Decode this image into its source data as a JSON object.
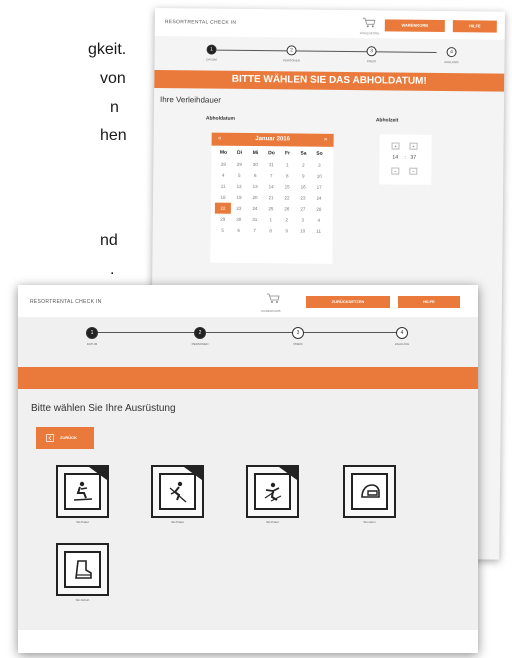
{
  "background_text": {
    "lines": [
      "gkeit.",
      "von",
      "n",
      "hen",
      "",
      "nd",
      "."
    ]
  },
  "back_window": {
    "brand": "RESORTRENTAL CHECK IN",
    "cart_label": "WARENKORB",
    "btn_primary": "WARENKORB",
    "btn_secondary": "HILFE",
    "steps": [
      {
        "num": "1",
        "label": "DATUM",
        "done": true
      },
      {
        "num": "2",
        "label": "PERSONEN",
        "done": false
      },
      {
        "num": "3",
        "label": "PREIS",
        "done": false
      },
      {
        "num": "4",
        "label": "ZAHLUNG",
        "done": false
      }
    ],
    "banner": "BITTE WÄHLEN SIE DAS ABHOLDATUM!",
    "section_title": "Ihre Verleihdauer",
    "date_label": "Abholdatum",
    "time_label": "Abholzeit",
    "calendar": {
      "month": "Januar 2016",
      "prev": "«",
      "next": "»",
      "weekdays": [
        "Mo",
        "Di",
        "Mi",
        "Do",
        "Fr",
        "Sa",
        "So"
      ],
      "rows": [
        [
          "28",
          "29",
          "30",
          "31",
          "1",
          "2",
          "3"
        ],
        [
          "4",
          "5",
          "6",
          "7",
          "8",
          "9",
          "10"
        ],
        [
          "11",
          "12",
          "13",
          "14",
          "15",
          "16",
          "17"
        ],
        [
          "18",
          "19",
          "20",
          "21",
          "22",
          "23",
          "24"
        ],
        [
          "22",
          "23",
          "24",
          "25",
          "26",
          "27",
          "28"
        ],
        [
          "29",
          "30",
          "31",
          "1",
          "2",
          "3",
          "4"
        ],
        [
          "5",
          "6",
          "7",
          "8",
          "9",
          "10",
          "11"
        ]
      ],
      "selected": "22"
    },
    "time": {
      "hour": "14",
      "sep": ":",
      "minute": "37",
      "up": "+",
      "down": "−"
    }
  },
  "front_window": {
    "brand": "RESORTRENTAL CHECK IN",
    "cart_label": "WARENKORB",
    "btn_primary": "ZURÜCKSETZEN",
    "btn_secondary": "HILFE",
    "steps": [
      {
        "num": "1",
        "label": "DATUM",
        "done": true
      },
      {
        "num": "2",
        "label": "PERSONEN",
        "done": true
      },
      {
        "num": "3",
        "label": "PREIS",
        "done": false
      },
      {
        "num": "4",
        "label": "ZAHLUNG",
        "done": false
      }
    ],
    "section_title": "Bitte wählen Sie Ihre Ausrüstung",
    "back_button": "ZURÜCK",
    "back_icon": "arrow-left-icon",
    "tiles": [
      {
        "label": "Ski-Paket",
        "icon": "ski-sitting-icon",
        "corner": true
      },
      {
        "label": "Ski-Paket",
        "icon": "ski-downhill-icon",
        "corner": true
      },
      {
        "label": "Ski-Paket",
        "icon": "ski-freestyle-icon",
        "corner": true
      },
      {
        "label": "Ski-Helm",
        "icon": "helmet-icon",
        "corner": false
      },
      {
        "label": "Ski-Schuh",
        "icon": "boot-icon",
        "corner": false
      }
    ]
  },
  "colors": {
    "accent": "#ea7a3b",
    "dark": "#222222"
  }
}
